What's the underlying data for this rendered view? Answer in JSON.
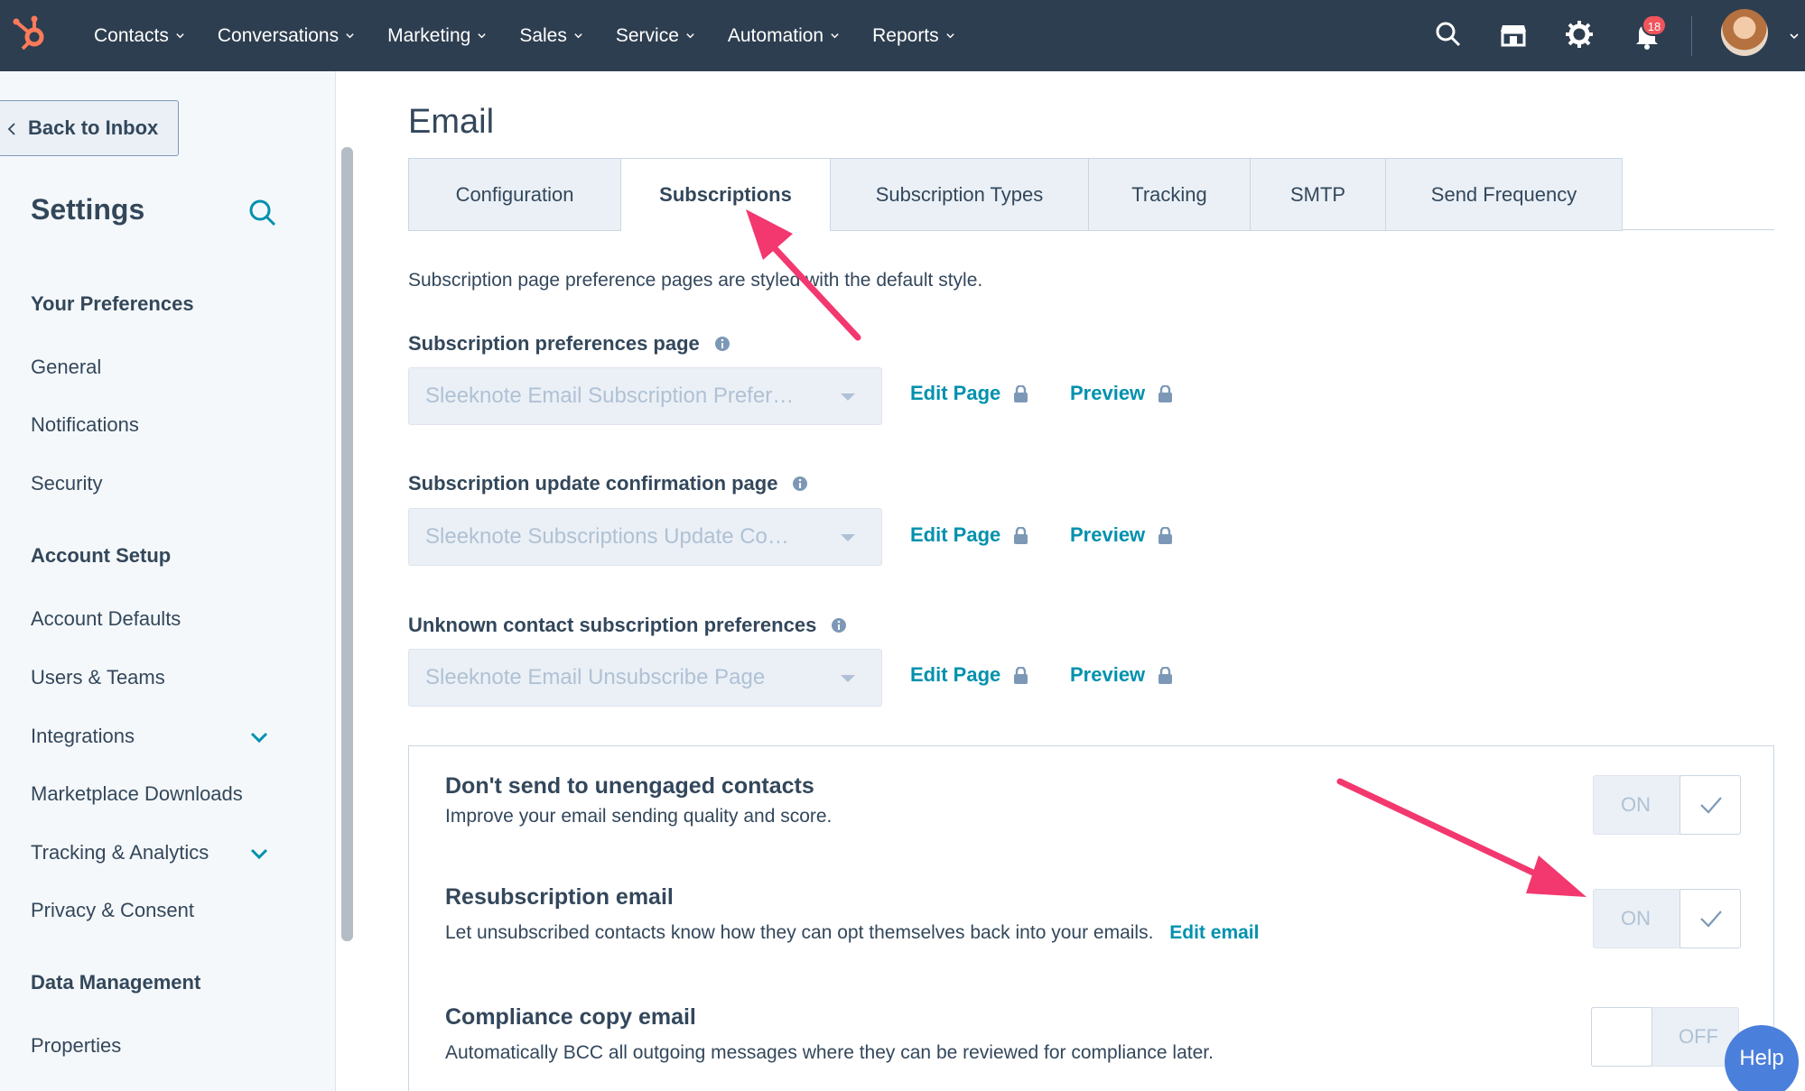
{
  "topnav": {
    "menu": [
      {
        "label": "Contacts"
      },
      {
        "label": "Conversations"
      },
      {
        "label": "Marketing"
      },
      {
        "label": "Sales"
      },
      {
        "label": "Service"
      },
      {
        "label": "Automation"
      },
      {
        "label": "Reports"
      }
    ],
    "notification_count": "18",
    "icons": [
      "hubspot-logo-icon",
      "search-icon",
      "marketplace-icon",
      "gear-icon",
      "bell-icon",
      "avatar"
    ]
  },
  "sidebar": {
    "back_label": "Back to Inbox",
    "title": "Settings",
    "sections": [
      {
        "heading": "Your Preferences",
        "items": [
          "General",
          "Notifications",
          "Security"
        ]
      },
      {
        "heading": "Account Setup",
        "items": [
          "Account Defaults",
          "Users & Teams",
          "Integrations",
          "Marketplace Downloads",
          "Tracking & Analytics",
          "Privacy & Consent"
        ]
      },
      {
        "heading": "Data Management",
        "items": [
          "Properties"
        ]
      }
    ]
  },
  "main": {
    "title": "Email",
    "tabs": [
      {
        "label": "Configuration"
      },
      {
        "label": "Subscriptions",
        "active": true
      },
      {
        "label": "Subscription Types"
      },
      {
        "label": "Tracking"
      },
      {
        "label": "SMTP"
      },
      {
        "label": "Send Frequency"
      }
    ],
    "intro": "Subscription page preference pages are styled with the default style.",
    "fields": [
      {
        "label": "Subscription preferences page",
        "value": "Sleeknote Email Subscription Prefer…",
        "edit": "Edit Page",
        "preview": "Preview"
      },
      {
        "label": "Subscription update confirmation page",
        "value": "Sleeknote Subscriptions Update Co…",
        "edit": "Edit Page",
        "preview": "Preview"
      },
      {
        "label": "Unknown contact subscription preferences",
        "value": "Sleeknote Email Unsubscribe Page",
        "edit": "Edit Page",
        "preview": "Preview"
      }
    ],
    "settings": [
      {
        "title": "Don't send to unengaged contacts",
        "desc": "Improve your email sending quality and score.",
        "state": "ON"
      },
      {
        "title": "Resubscription email",
        "desc": "Let unsubscribed contacts know how they can opt themselves back into your emails.",
        "link": "Edit email",
        "state": "ON"
      },
      {
        "title": "Compliance copy email",
        "desc": "Automatically BCC all outgoing messages where they can be reviewed for compliance later.",
        "state": "OFF"
      }
    ]
  },
  "help_label": "Help",
  "colors": {
    "nav_bg": "#2d3e50",
    "accent": "#0091ae",
    "annotation_arrow": "#f2386f",
    "badge": "#f2545b"
  }
}
